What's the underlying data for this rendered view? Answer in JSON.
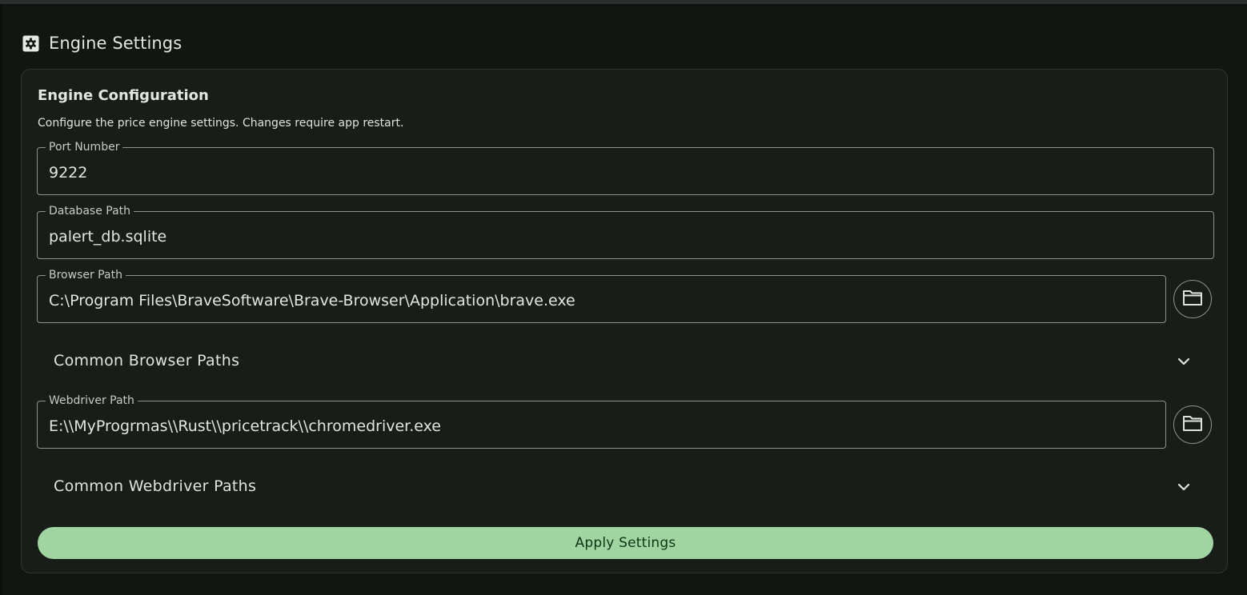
{
  "header": {
    "icon": "gear-icon",
    "title": "Engine Settings"
  },
  "card": {
    "title": "Engine Configuration",
    "description": "Configure the price engine settings. Changes require app restart."
  },
  "fields": {
    "port": {
      "label": "Port Number",
      "value": "9222"
    },
    "database": {
      "label": "Database Path",
      "value": "palert_db.sqlite"
    },
    "browser": {
      "label": "Browser Path",
      "value": "C:\\Program Files\\BraveSoftware\\Brave-Browser\\Application\\brave.exe",
      "button_icon": "folder-icon"
    },
    "webdriver": {
      "label": "Webdriver Path",
      "value": "E:\\\\MyProgrmas\\\\Rust\\\\pricetrack\\\\chromedriver.exe",
      "button_icon": "folder-icon"
    }
  },
  "expanders": {
    "browser_paths": {
      "label": "Common Browser Paths",
      "icon": "chevron-down-icon"
    },
    "webdriver_paths": {
      "label": "Common Webdriver Paths",
      "icon": "chevron-down-icon"
    }
  },
  "apply_button": {
    "label": "Apply Settings"
  },
  "colors": {
    "background": "#111612",
    "card": "#191d19",
    "accent": "#a0d4a1",
    "accent_text": "#0f3417",
    "outline": "#8d948b"
  }
}
